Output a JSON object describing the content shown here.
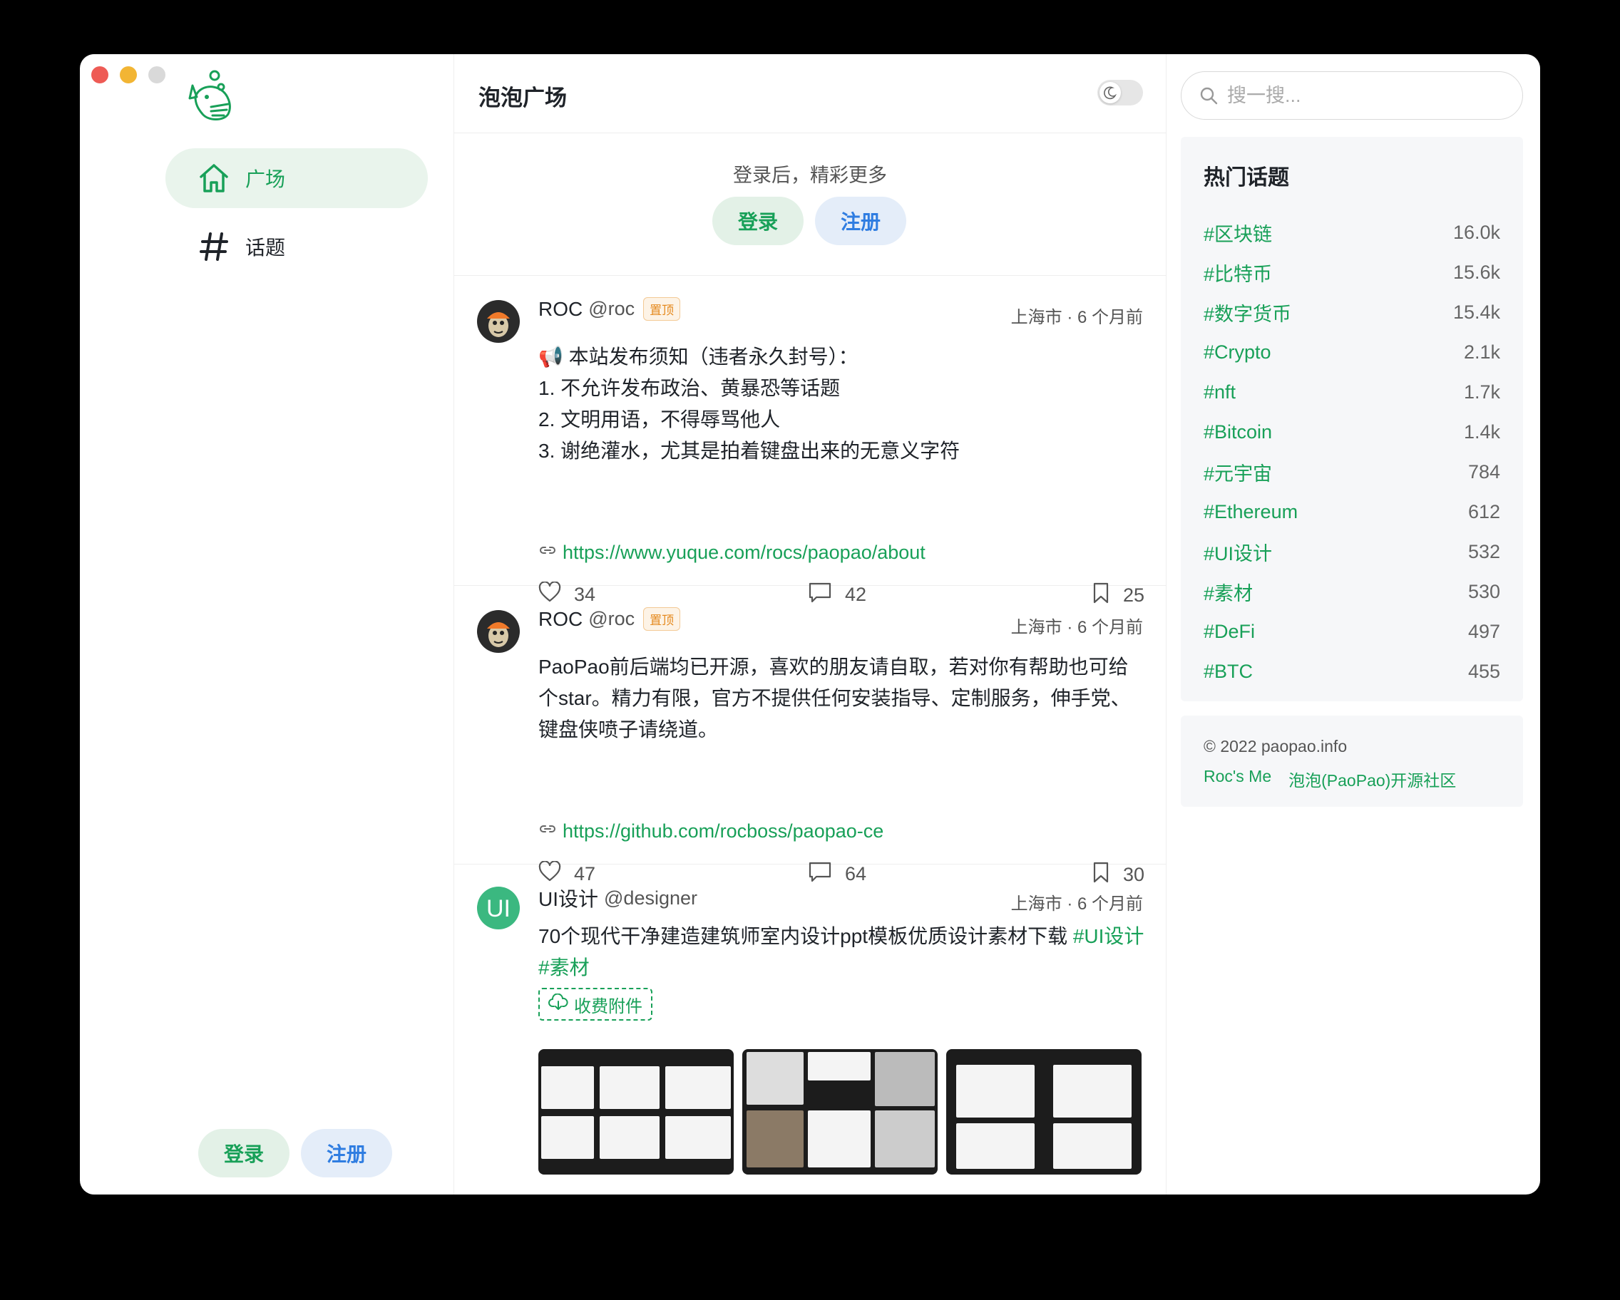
{
  "window_controls": [
    "close",
    "minimize",
    "zoom"
  ],
  "sidebar": {
    "logo_icon": "bubble-whale-logo",
    "items": [
      {
        "label": "广场",
        "icon": "home-icon",
        "active": true
      },
      {
        "label": "话题",
        "icon": "hash-icon",
        "active": false
      }
    ],
    "login_label": "登录",
    "register_label": "注册"
  },
  "header": {
    "title": "泡泡广场",
    "theme_toggle_icon": "moon-icon"
  },
  "login_panel": {
    "tip": "登录后，精彩更多",
    "login_label": "登录",
    "register_label": "注册"
  },
  "posts": [
    {
      "nickname": "ROC",
      "handle": "@roc",
      "badge": "置顶",
      "meta": "上海市 · 6 个月前",
      "lines": [
        "📢 本站发布须知（违者永久封号）：",
        "1. 不允许发布政治、黄暴恐等话题",
        "2. 文明用语，不得辱骂他人",
        "3. 谢绝灌水，尤其是拍着键盘出来的无意义字符"
      ],
      "link": "https://www.yuque.com/rocs/paopao/about",
      "likes": "34",
      "comments": "42",
      "collections": "25"
    },
    {
      "nickname": "ROC",
      "handle": "@roc",
      "badge": "置顶",
      "meta": "上海市 · 6 个月前",
      "text": "PaoPao前后端均已开源，喜欢的朋友请自取，若对你有帮助也可给个star。精力有限，官方不提供任何安装指导、定制服务，伸手党、键盘侠喷子请绕道。",
      "link": "https://github.com/rocboss/paopao-ce",
      "likes": "47",
      "comments": "64",
      "collections": "30"
    },
    {
      "nickname": "UI设计",
      "handle": "@designer",
      "avatar_text": "UI",
      "meta": "上海市 · 6 个月前",
      "text_before": "70个现代干净建造建筑师室内设计ppt模板优质设计素材下载 ",
      "tags": [
        "#UI设计",
        "#素材"
      ],
      "attachment_label": "收费附件"
    }
  ],
  "right": {
    "search_placeholder": "搜一搜...",
    "hot_title": "热门话题",
    "topics": [
      {
        "tag": "#区块链",
        "count": "16.0k"
      },
      {
        "tag": "#比特币",
        "count": "15.6k"
      },
      {
        "tag": "#数字货币",
        "count": "15.4k"
      },
      {
        "tag": "#Crypto",
        "count": "2.1k"
      },
      {
        "tag": "#nft",
        "count": "1.7k"
      },
      {
        "tag": "#Bitcoin",
        "count": "1.4k"
      },
      {
        "tag": "#元宇宙",
        "count": "784"
      },
      {
        "tag": "#Ethereum",
        "count": "612"
      },
      {
        "tag": "#UI设计",
        "count": "532"
      },
      {
        "tag": "#素材",
        "count": "530"
      },
      {
        "tag": "#DeFi",
        "count": "497"
      },
      {
        "tag": "#BTC",
        "count": "455"
      }
    ],
    "copyright": "© 2022 paopao.info",
    "links": [
      "Roc's Me",
      "泡泡(PaoPao)开源社区"
    ]
  },
  "colors": {
    "accent": "#18a058",
    "blue": "#2f7de1",
    "badge": "#e58a1f"
  }
}
